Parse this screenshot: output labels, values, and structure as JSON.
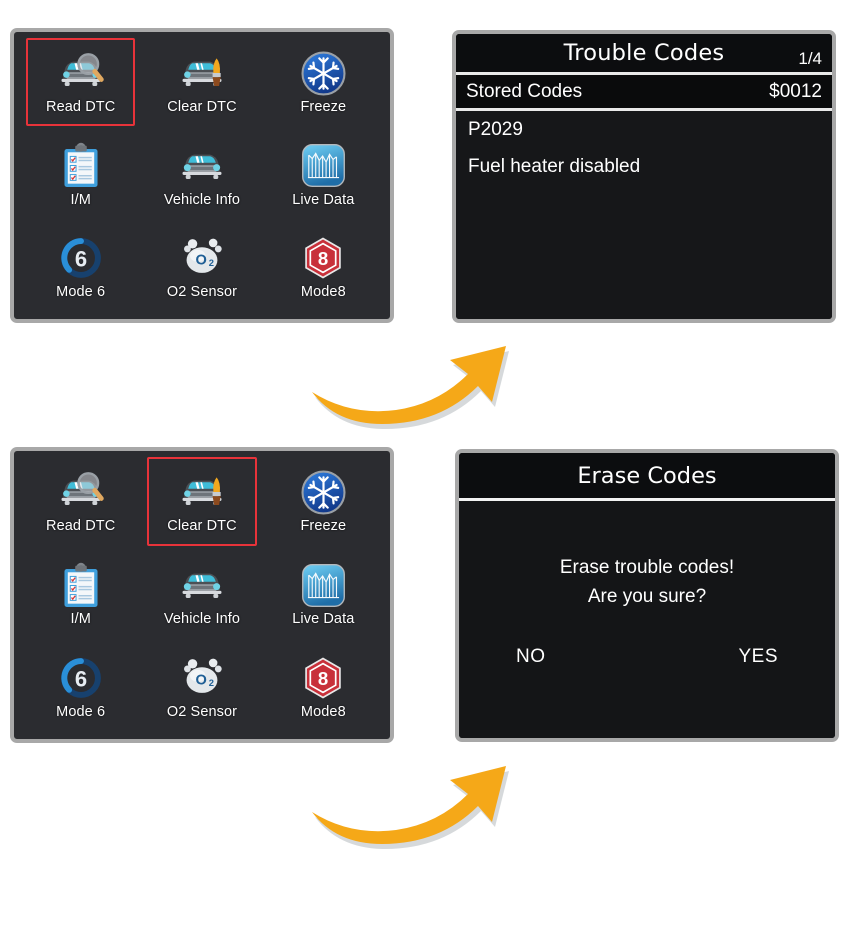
{
  "menu": {
    "items": [
      {
        "label": "Read DTC",
        "icon": "car-magnifier-icon"
      },
      {
        "label": "Clear DTC",
        "icon": "car-brush-icon"
      },
      {
        "label": "Freeze",
        "icon": "snowflake-icon"
      },
      {
        "label": "I/M",
        "icon": "clipboard-checklist-icon"
      },
      {
        "label": "Vehicle Info",
        "icon": "car-front-icon"
      },
      {
        "label": "Live Data",
        "icon": "waveform-graph-icon"
      },
      {
        "label": "Mode 6",
        "icon": "circle-six-icon"
      },
      {
        "label": "O2 Sensor",
        "icon": "o2-molecule-icon"
      },
      {
        "label": "Mode8",
        "icon": "hexagon-eight-icon"
      }
    ],
    "selection_step_1": "Read DTC",
    "selection_step_2": "Clear DTC",
    "highlight_color": "#e8333a"
  },
  "trouble_codes_screen": {
    "title": "Trouble Codes",
    "page_indicator": "1/4",
    "row_label": "Stored Codes",
    "row_value": "$0012",
    "code": "P2029",
    "description": "Fuel heater disabled"
  },
  "erase_codes_screen": {
    "title": "Erase Codes",
    "message_line_1": "Erase trouble codes!",
    "message_line_2": "Are you sure?",
    "button_no": "NO",
    "button_yes": "YES"
  },
  "flow": {
    "arrow_1_name": "flow-arrow-read-dtc",
    "arrow_2_name": "flow-arrow-clear-dtc",
    "arrow_color": "#f5a818"
  }
}
